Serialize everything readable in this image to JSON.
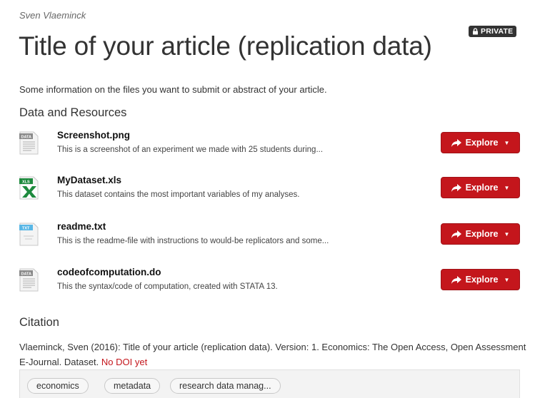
{
  "author": "Sven Vlaeminck",
  "private_label": "PRIVATE",
  "title": "Title of your article (replication data)",
  "notes": "Some information on the files you want to submit or abstract of your article.",
  "resources_heading": "Data and Resources",
  "resources": [
    {
      "name": "Screenshot.png",
      "description": "This is a screenshot of an experiment we made with 25 students during...",
      "format_label": "DATA",
      "icon": "data-file-icon",
      "explore_label": "Explore"
    },
    {
      "name": "MyDataset.xls",
      "description": "This dataset contains the most important variables of my analyses.",
      "format_label": "XLS",
      "icon": "excel-file-icon",
      "explore_label": "Explore"
    },
    {
      "name": "readme.txt",
      "description": "This is the readme-file with instructions to would-be replicators and some...",
      "format_label": "TXT",
      "icon": "text-file-icon",
      "explore_label": "Explore"
    },
    {
      "name": "codeofcomputation.do",
      "description": "This the syntax/code of computation, created with STATA 13.",
      "format_label": "DATA",
      "icon": "data-file-icon",
      "explore_label": "Explore"
    }
  ],
  "citation_heading": "Citation",
  "citation_text": "Vlaeminck, Sven (2016): Title of your article (replication data). Version: 1. Economics: The Open Access, Open Assessment E-Journal. Dataset.",
  "citation_doi": "No DOI yet",
  "tags": [
    "economics",
    "metadata",
    "research data manag..."
  ],
  "colors": {
    "accent": "#c4161c",
    "badge": "#333333",
    "xls_green": "#1e8a3e",
    "txt_blue": "#59b7e6",
    "data_grey": "#8a8a8a"
  }
}
